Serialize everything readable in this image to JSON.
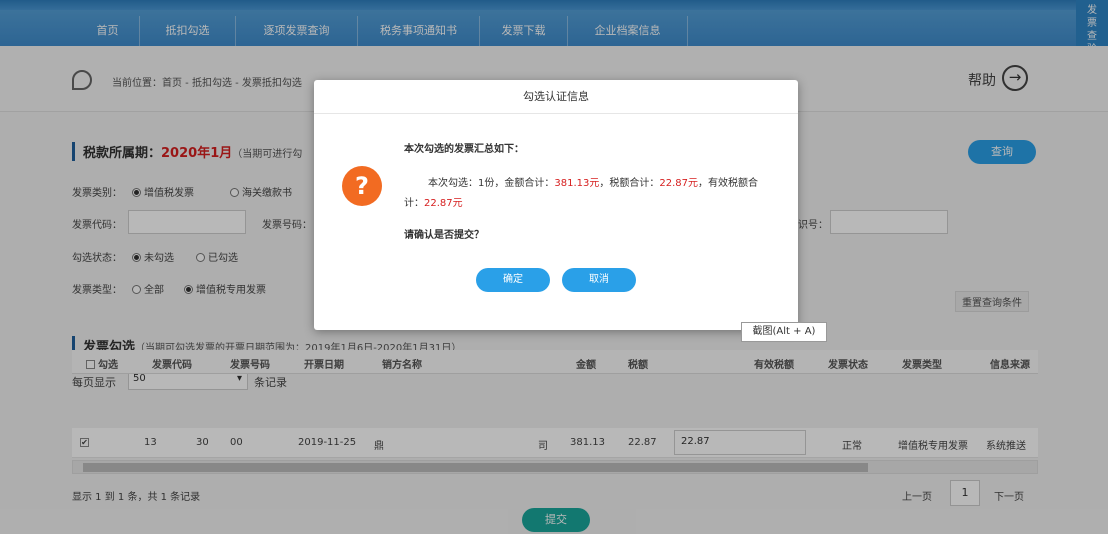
{
  "nav": {
    "items": [
      {
        "label": "首页"
      },
      {
        "label": "抵扣勾选"
      },
      {
        "label": "逐项发票查询"
      },
      {
        "label": "税务事项通知书"
      },
      {
        "label": "发票下载"
      },
      {
        "label": "企业档案信息"
      }
    ],
    "side_tab": "发票查验平台"
  },
  "breadcrumb": {
    "text": "当前位置：首页 - 抵扣勾选 - 发票抵扣勾选",
    "help_label": "帮助"
  },
  "tax_period": {
    "title": "税款所属期：",
    "value": "2020年1月",
    "note": "（当期可进行勾"
  },
  "query_button": "查询",
  "filters": {
    "invoice_category_label": "发票类别：",
    "invoice_category_options": [
      "增值税发票",
      "海关缴款书"
    ],
    "invoice_code_label": "发票代码：",
    "invoice_number_label": "发票号码：",
    "seller_id_label": "识号：",
    "check_status_label": "勾选状态：",
    "check_status_options": [
      "未勾选",
      "已勾选"
    ],
    "invoice_type_label": "发票类型：",
    "invoice_type_options": [
      "全部",
      "增值税专用发票"
    ],
    "reset_label": "重置查询条件"
  },
  "invoice_section": {
    "title": "发票勾选",
    "note": "（当期可勾选发票的开票日期范围为：2019年1月6日-2020年1月31日）"
  },
  "page_size": {
    "prefix": "每页显示",
    "value": "50",
    "suffix": "条记录"
  },
  "table": {
    "headers": [
      "勾选",
      "发票代码",
      "发票号码",
      "开票日期",
      "销方名称",
      "金额",
      "税额",
      "有效税额",
      "发票状态",
      "发票类型",
      "信息来源"
    ],
    "rows": [
      {
        "checked": "✔",
        "code": "13",
        "code_tail": "30",
        "number": "00",
        "date": "2019-11-25",
        "seller": "鼎",
        "seller_tail": "司",
        "amount": "381.13",
        "tax": "22.87",
        "valid_tax": "22.87",
        "status": "正常",
        "type": "增值税专用发票",
        "source": "系统推送"
      }
    ]
  },
  "pagination": {
    "summary": "显示 1 到 1 条，共 1 条记录",
    "prev": "上一页",
    "current": "1",
    "next": "下一页"
  },
  "submit_button": "提交",
  "tooltip": "截图(Alt + A)",
  "dialog": {
    "title": "勾选认证信息",
    "summary_heading": "本次勾选的发票汇总如下：",
    "line_prefix": "本次勾选：",
    "count": "1份",
    "amount_label": "，金额合计：",
    "amount": "381.13元",
    "tax_label": "，税额合计：",
    "tax": "22.87元",
    "valid_label": "，有效税额合计：",
    "valid": "22.87元",
    "confirm_question": "请确认是否提交？",
    "ok_button": "确定",
    "cancel_button": "取消"
  },
  "colors": {
    "nav": "#3f8ccc",
    "accent_red": "#d61f1f",
    "button_blue": "#2aa0e8",
    "question_orange": "#f26b22",
    "submit_teal": "#1aa79c"
  }
}
